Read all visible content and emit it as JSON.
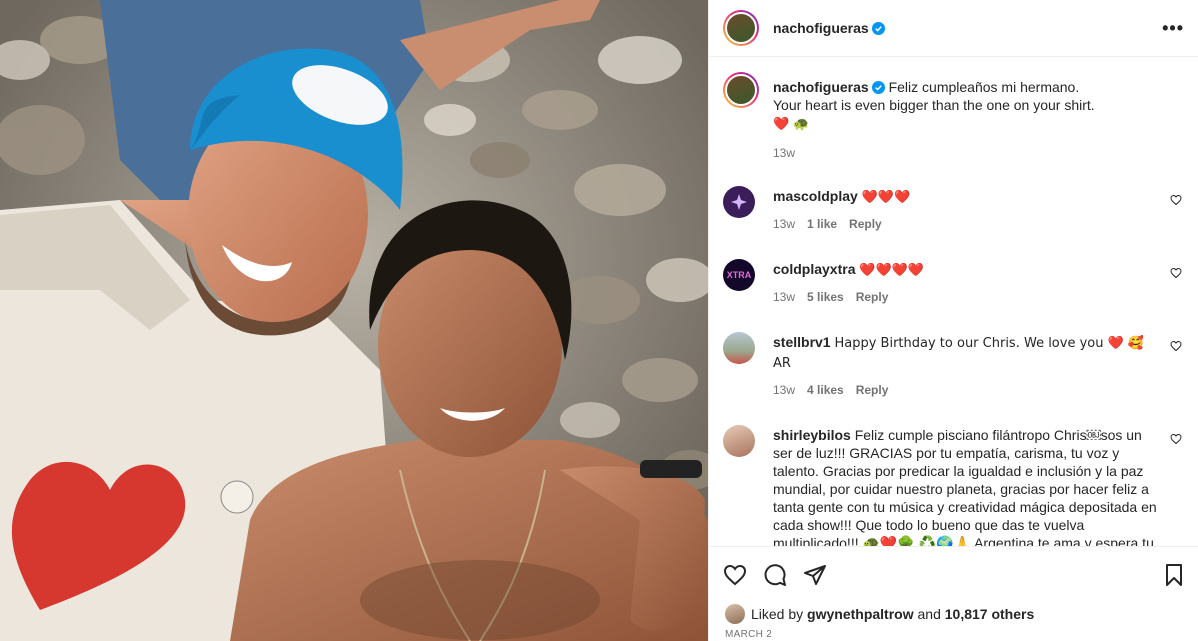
{
  "post": {
    "author": "nachofigueras",
    "date": "MARCH 2"
  },
  "caption": {
    "username": "nachofigueras",
    "line1": "Feliz cumpleaños mi hermano.",
    "line2": "Your heart is even bigger than the one on your shirt.",
    "emoji": "❤️ 🐢",
    "time": "13w"
  },
  "comments": [
    {
      "username": "mascoldplay",
      "text": "❤️❤️❤️",
      "time": "13w",
      "likes": "1 like",
      "reply": "Reply",
      "avatar_color": "#3b1d5a"
    },
    {
      "username": "coldplayxtra",
      "text": "❤️❤️❤️❤️",
      "time": "13w",
      "likes": "5 likes",
      "reply": "Reply",
      "avatar_color": "#14082a"
    },
    {
      "username": "stellbrv1",
      "text": "Happy Birthday to our Chris. We love you ❤️ 🥰 AR",
      "time": "13w",
      "likes": "4 likes",
      "reply": "Reply",
      "avatar_color": "#8a9fb4"
    },
    {
      "username": "shirleybilos",
      "text": "Feliz cumple pisciano filántropo Chris￼sos un ser de luz!!! GRACIAS por tu empatía, carisma, tu voz y talento. Gracias por predicar la igualdad e inclusión y la paz mundial, por cuidar nuestro planeta, gracias por hacer feliz a tanta gente con tu música y creatividad mágica depositada en cada show!!! Que todo lo bueno que das te vuelva multiplicado!!! 🐢❤️🌳 ♻️🌍🙏 Argentina te ama y espera tu regreso siempre!!! Nacho gracias por esa amistad tan linda que tienen, no me quedan dudas de que deben compartir los mismos valores!!! gracias por ser el puente para que este saludo le pueda llegar",
      "avatar_color": "#c9a38e"
    }
  ],
  "likes": {
    "prefix": "Liked by",
    "user": "gwynethpaltrow",
    "conj": "and",
    "count": "10,817 others"
  },
  "colors": {
    "verified": "#0095f6",
    "text": "#262626",
    "muted": "#737373",
    "heart": "#e0245e"
  },
  "icons": [
    "verified-badge-icon",
    "more-options-icon",
    "heart-icon",
    "comment-icon",
    "share-icon",
    "bookmark-icon"
  ]
}
